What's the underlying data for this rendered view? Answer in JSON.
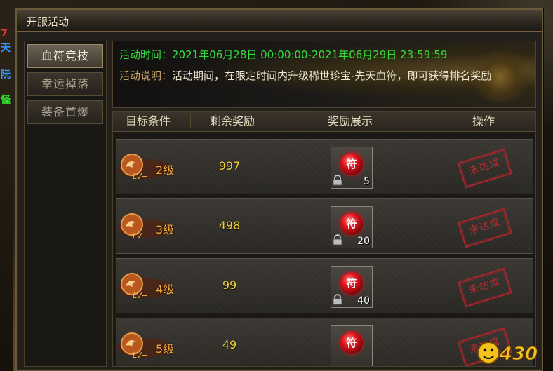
{
  "window": {
    "title": "开服活动"
  },
  "sidebar": {
    "items": [
      {
        "label": "血符竞技",
        "active": true
      },
      {
        "label": "幸运掉落",
        "active": false
      },
      {
        "label": "装备首爆",
        "active": false
      }
    ]
  },
  "banner": {
    "time_label": "活动时间：",
    "time_value": "2021年06月28日 00:00:00-2021年06月29日 23:59:59",
    "desc_label": "活动说明：",
    "desc_value": "活动期间，在限定时间内升级稀世珍宝-先天血符，即可获得排名奖励"
  },
  "table": {
    "headers": [
      "目标条件",
      "剩余奖励",
      "奖励展示",
      "操作"
    ],
    "rows": [
      {
        "level": "2级",
        "remaining": "997",
        "reward_qty": "5",
        "status": "未达成"
      },
      {
        "level": "3级",
        "remaining": "498",
        "reward_qty": "20",
        "status": "未达成"
      },
      {
        "level": "4级",
        "remaining": "99",
        "reward_qty": "40",
        "status": "未达成"
      },
      {
        "level": "5级",
        "remaining": "49",
        "reward_qty": "",
        "status": "未达成"
      }
    ],
    "badge_text": "LV+",
    "reward_item_icon": "blood-rune-orb-icon"
  },
  "watermark": {
    "text": "430"
  },
  "colors": {
    "green": "#33e03a",
    "gold_label": "#c8a46a",
    "count_yellow": "#f0d23a",
    "level_orange": "#f2a93a",
    "stamp_red": "#c42d34"
  }
}
